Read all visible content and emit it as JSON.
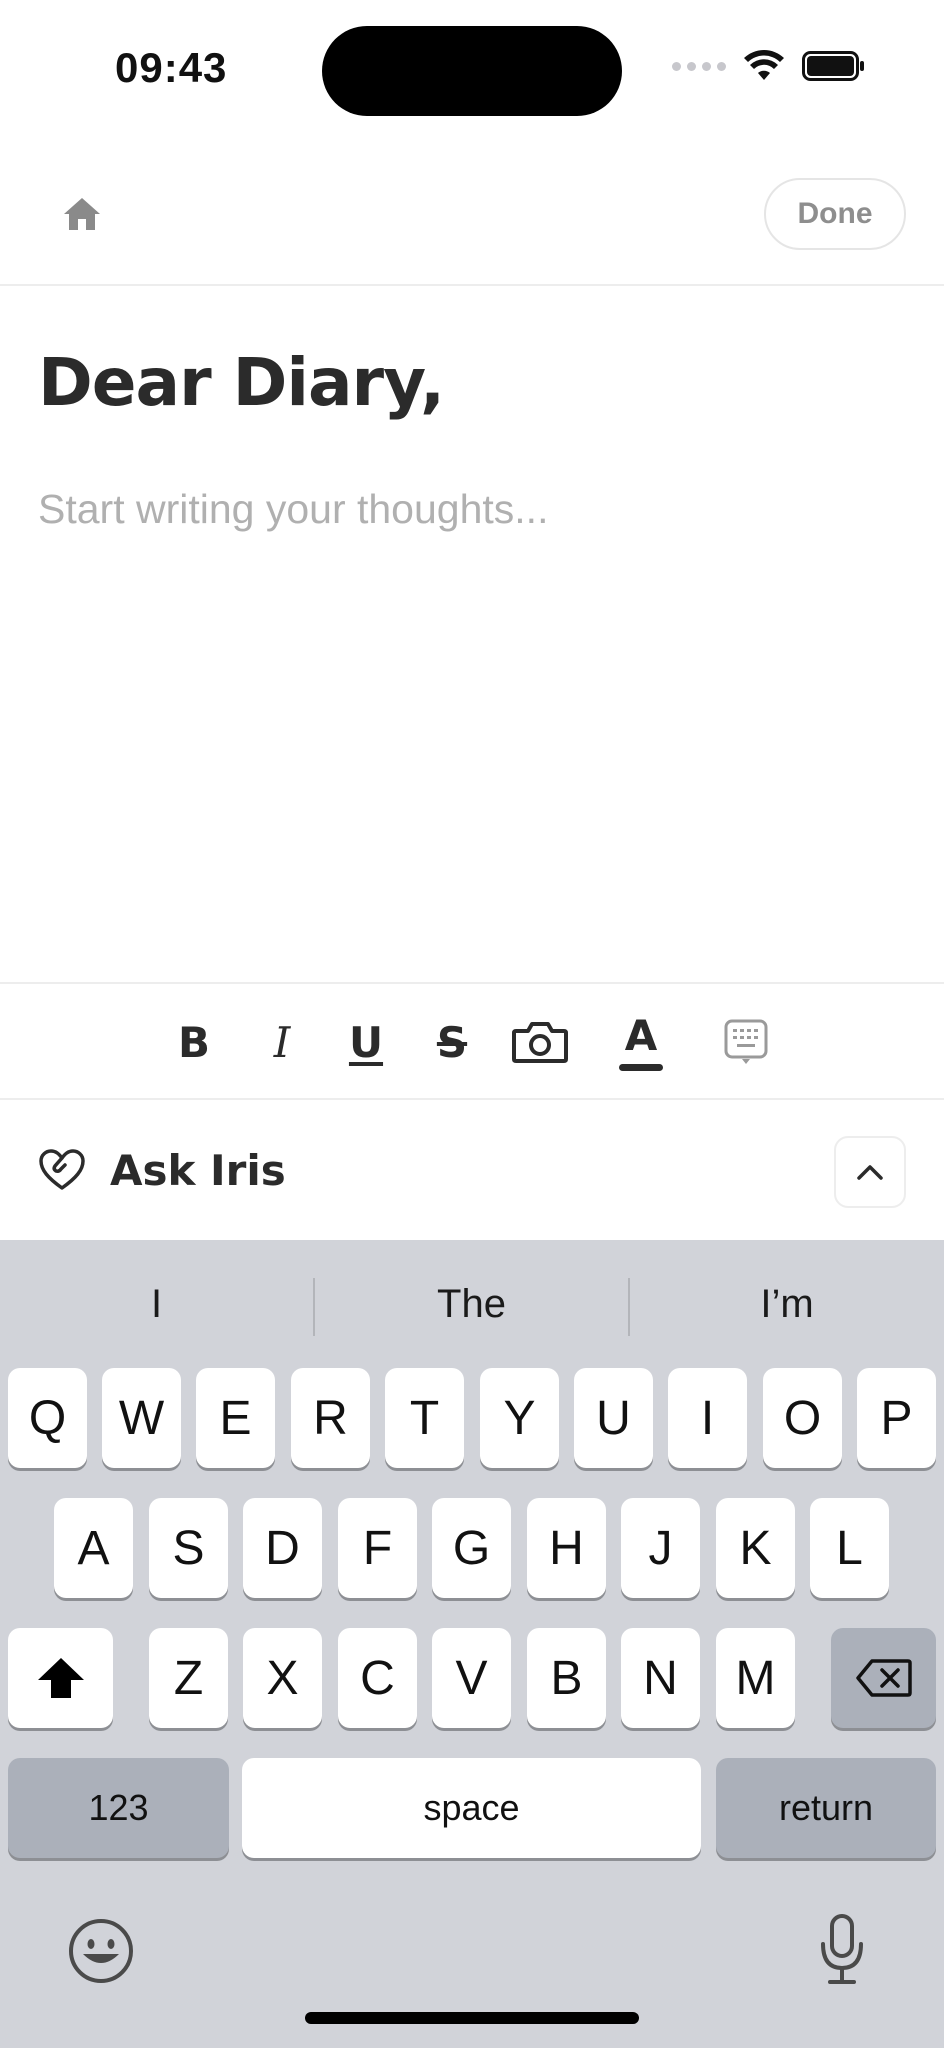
{
  "status_bar": {
    "time": "09:43"
  },
  "header": {
    "done_label": "Done"
  },
  "editor": {
    "title": "Dear Diary,",
    "body_value": "",
    "body_placeholder": "Start writing your thoughts..."
  },
  "format_toolbar": {
    "bold": "B",
    "italic": "I",
    "underline": "U",
    "strikethrough": "S",
    "text_color": "A",
    "text_color_value": "#2b2b2b"
  },
  "ask_iris": {
    "label": "Ask Iris"
  },
  "keyboard": {
    "suggestions": [
      "I",
      "The",
      "I’m"
    ],
    "row1": [
      "Q",
      "W",
      "E",
      "R",
      "T",
      "Y",
      "U",
      "I",
      "O",
      "P"
    ],
    "row2": [
      "A",
      "S",
      "D",
      "F",
      "G",
      "H",
      "J",
      "K",
      "L"
    ],
    "row3": [
      "Z",
      "X",
      "C",
      "V",
      "B",
      "N",
      "M"
    ],
    "numbers_label": "123",
    "space_label": "space",
    "return_label": "return"
  },
  "icons": {
    "home": "home-icon",
    "camera": "camera-icon",
    "keyboard_hide": "keyboard-hide-icon",
    "heart": "heart-hands-icon",
    "chevron": "chevron-up-icon",
    "shift": "shift-icon",
    "delete": "delete-icon",
    "emoji": "emoji-icon",
    "mic": "microphone-icon"
  }
}
